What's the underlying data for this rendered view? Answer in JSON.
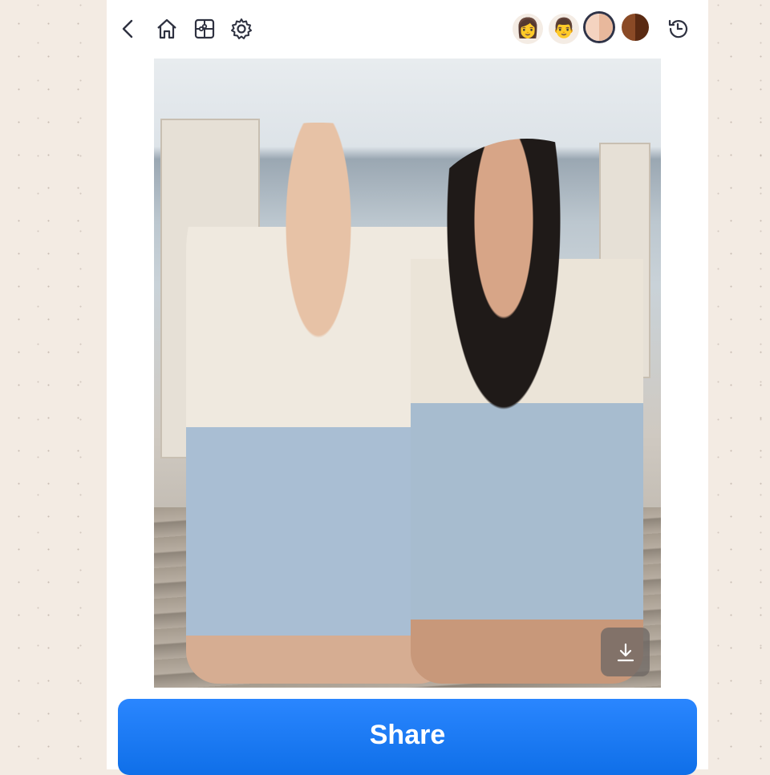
{
  "toolbar": {
    "icons": [
      "back-icon",
      "home-icon",
      "puzzle-icon",
      "gear-icon",
      "history-icon"
    ]
  },
  "style_options": {
    "avatars": [
      {
        "name": "woman-avatar",
        "glyph": "👩"
      },
      {
        "name": "man-avatar",
        "glyph": "👨"
      }
    ],
    "skin_tones": [
      {
        "name": "light",
        "colors": [
          "#f4d3c0",
          "#e8b89c"
        ],
        "selected": true
      },
      {
        "name": "dark",
        "colors": [
          "#8a4a26",
          "#5a2a12"
        ],
        "selected": false
      }
    ]
  },
  "image": {
    "download_icon": "download-icon"
  },
  "share_button": {
    "label": "Share",
    "color": "#1a7af8"
  }
}
